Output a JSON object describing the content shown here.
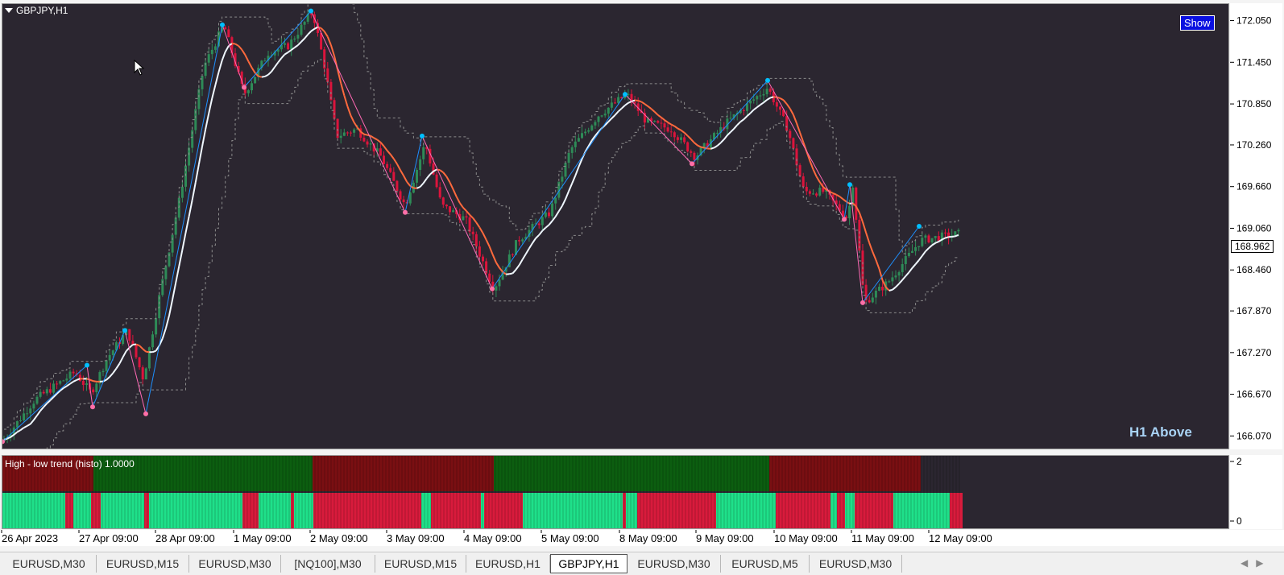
{
  "symbol": "GBPJPY,H1",
  "show_button": "Show",
  "trend_text": "H1 Above",
  "current_price": "168.962",
  "sub_title": "High - low trend (histo) 1.0000",
  "price_ticks": [
    "172.050",
    "171.450",
    "170.850",
    "170.260",
    "169.660",
    "169.060",
    "168.460",
    "167.870",
    "167.270",
    "166.670",
    "166.070"
  ],
  "sub_ticks": [
    "2",
    "0"
  ],
  "time_labels": [
    "26 Apr 2023",
    "27 Apr 09:00",
    "28 Apr 09:00",
    "1 May 09:00",
    "2 May 09:00",
    "3 May 09:00",
    "4 May 09:00",
    "5 May 09:00",
    "8 May 09:00",
    "9 May 09:00",
    "10 May 09:00",
    "11 May 09:00",
    "12 May 09:00"
  ],
  "tabs": [
    "EURUSD,M30",
    "EURUSD,M15",
    "EURUSD,M30",
    "[NQ100],M30",
    "EURUSD,M15",
    "EURUSD,H1",
    "GBPJPY,H1",
    "EURUSD,M30",
    "EURUSD,M5",
    "EURUSD,M30"
  ],
  "active_tab": 6,
  "colors": {
    "bull": "#2e8b57",
    "bear": "#dc143c",
    "bg": "#2b2630",
    "ma_bull": "#f0f8ff",
    "ma_bear": "#ff6a3d",
    "zig_up": "#1e90ff",
    "zig_dn": "#ff69b4",
    "hist_top_up": "#0c5e10",
    "hist_top_dn": "#7a0f12",
    "hist_bot_up": "#1fe08a",
    "hist_bot_dn": "#d81b3c"
  },
  "chart_data": {
    "type": "candlestick",
    "symbol": "GBPJPY",
    "timeframe": "H1",
    "x": [
      "26 Apr 2023",
      "27 Apr 09:00",
      "28 Apr 09:00",
      "1 May 09:00",
      "2 May 09:00",
      "3 May 09:00",
      "4 May 09:00",
      "5 May 09:00",
      "8 May 09:00",
      "9 May 09:00",
      "10 May 09:00",
      "11 May 09:00",
      "12 May 09:00"
    ],
    "ylim": [
      165.9,
      172.3
    ],
    "last_price": 168.962,
    "price_path": [
      [
        0,
        166.0
      ],
      [
        40,
        166.6
      ],
      [
        90,
        167.0
      ],
      [
        110,
        166.7
      ],
      [
        130,
        167.2
      ],
      [
        155,
        167.6
      ],
      [
        175,
        166.9
      ],
      [
        195,
        168.1
      ],
      [
        220,
        169.5
      ],
      [
        250,
        171.4
      ],
      [
        275,
        172.0
      ],
      [
        300,
        171.0
      ],
      [
        330,
        171.6
      ],
      [
        355,
        171.7
      ],
      [
        385,
        172.2
      ],
      [
        400,
        171.4
      ],
      [
        415,
        170.4
      ],
      [
        440,
        170.5
      ],
      [
        470,
        170.1
      ],
      [
        500,
        169.4
      ],
      [
        525,
        170.3
      ],
      [
        545,
        169.4
      ],
      [
        575,
        169.2
      ],
      [
        610,
        168.2
      ],
      [
        640,
        168.9
      ],
      [
        680,
        169.3
      ],
      [
        705,
        170.2
      ],
      [
        740,
        170.7
      ],
      [
        775,
        171.0
      ],
      [
        800,
        170.6
      ],
      [
        830,
        170.5
      ],
      [
        860,
        170.1
      ],
      [
        900,
        170.6
      ],
      [
        950,
        171.1
      ],
      [
        975,
        170.5
      ],
      [
        995,
        169.6
      ],
      [
        1020,
        169.6
      ],
      [
        1050,
        169.2
      ],
      [
        1055,
        169.8
      ],
      [
        1070,
        168.0
      ],
      [
        1100,
        168.3
      ],
      [
        1140,
        168.9
      ],
      [
        1190,
        169.0
      ]
    ],
    "zigzag_pivots": [
      [
        0,
        166.0
      ],
      [
        105,
        167.1
      ],
      [
        112,
        166.5
      ],
      [
        152,
        167.6
      ],
      [
        178,
        166.4
      ],
      [
        273,
        172.0
      ],
      [
        300,
        171.1
      ],
      [
        383,
        172.2
      ],
      [
        500,
        169.3
      ],
      [
        521,
        170.4
      ],
      [
        608,
        168.2
      ],
      [
        773,
        171.0
      ],
      [
        856,
        170.0
      ],
      [
        950,
        171.2
      ],
      [
        1045,
        169.2
      ],
      [
        1052,
        169.7
      ],
      [
        1068,
        168.0
      ],
      [
        1138,
        169.1
      ]
    ],
    "subwindow": {
      "name": "High - low trend (histo)",
      "value": 1.0,
      "ylim": [
        0,
        2
      ],
      "top_segments": [
        [
          0,
          113,
          "down"
        ],
        [
          113,
          385,
          "up"
        ],
        [
          385,
          610,
          "down"
        ],
        [
          610,
          952,
          "up"
        ],
        [
          952,
          1140,
          "down"
        ]
      ],
      "bottom_segments": [
        [
          0,
          78,
          "up"
        ],
        [
          78,
          88,
          "down"
        ],
        [
          88,
          110,
          "up"
        ],
        [
          110,
          122,
          "down"
        ],
        [
          122,
          176,
          "up"
        ],
        [
          176,
          182,
          "down"
        ],
        [
          182,
          298,
          "up"
        ],
        [
          298,
          318,
          "down"
        ],
        [
          318,
          358,
          "up"
        ],
        [
          358,
          362,
          "down"
        ],
        [
          362,
          386,
          "up"
        ],
        [
          386,
          520,
          "down"
        ],
        [
          520,
          532,
          "up"
        ],
        [
          532,
          594,
          "down"
        ],
        [
          594,
          598,
          "up"
        ],
        [
          598,
          646,
          "down"
        ],
        [
          646,
          770,
          "up"
        ],
        [
          770,
          774,
          "down"
        ],
        [
          774,
          788,
          "up"
        ],
        [
          788,
          886,
          "down"
        ],
        [
          886,
          960,
          "up"
        ],
        [
          960,
          1028,
          "down"
        ],
        [
          1028,
          1036,
          "up"
        ],
        [
          1036,
          1046,
          "down"
        ],
        [
          1046,
          1058,
          "up"
        ],
        [
          1058,
          1106,
          "down"
        ],
        [
          1106,
          1176,
          "up"
        ],
        [
          1176,
          1192,
          "down"
        ]
      ]
    }
  }
}
